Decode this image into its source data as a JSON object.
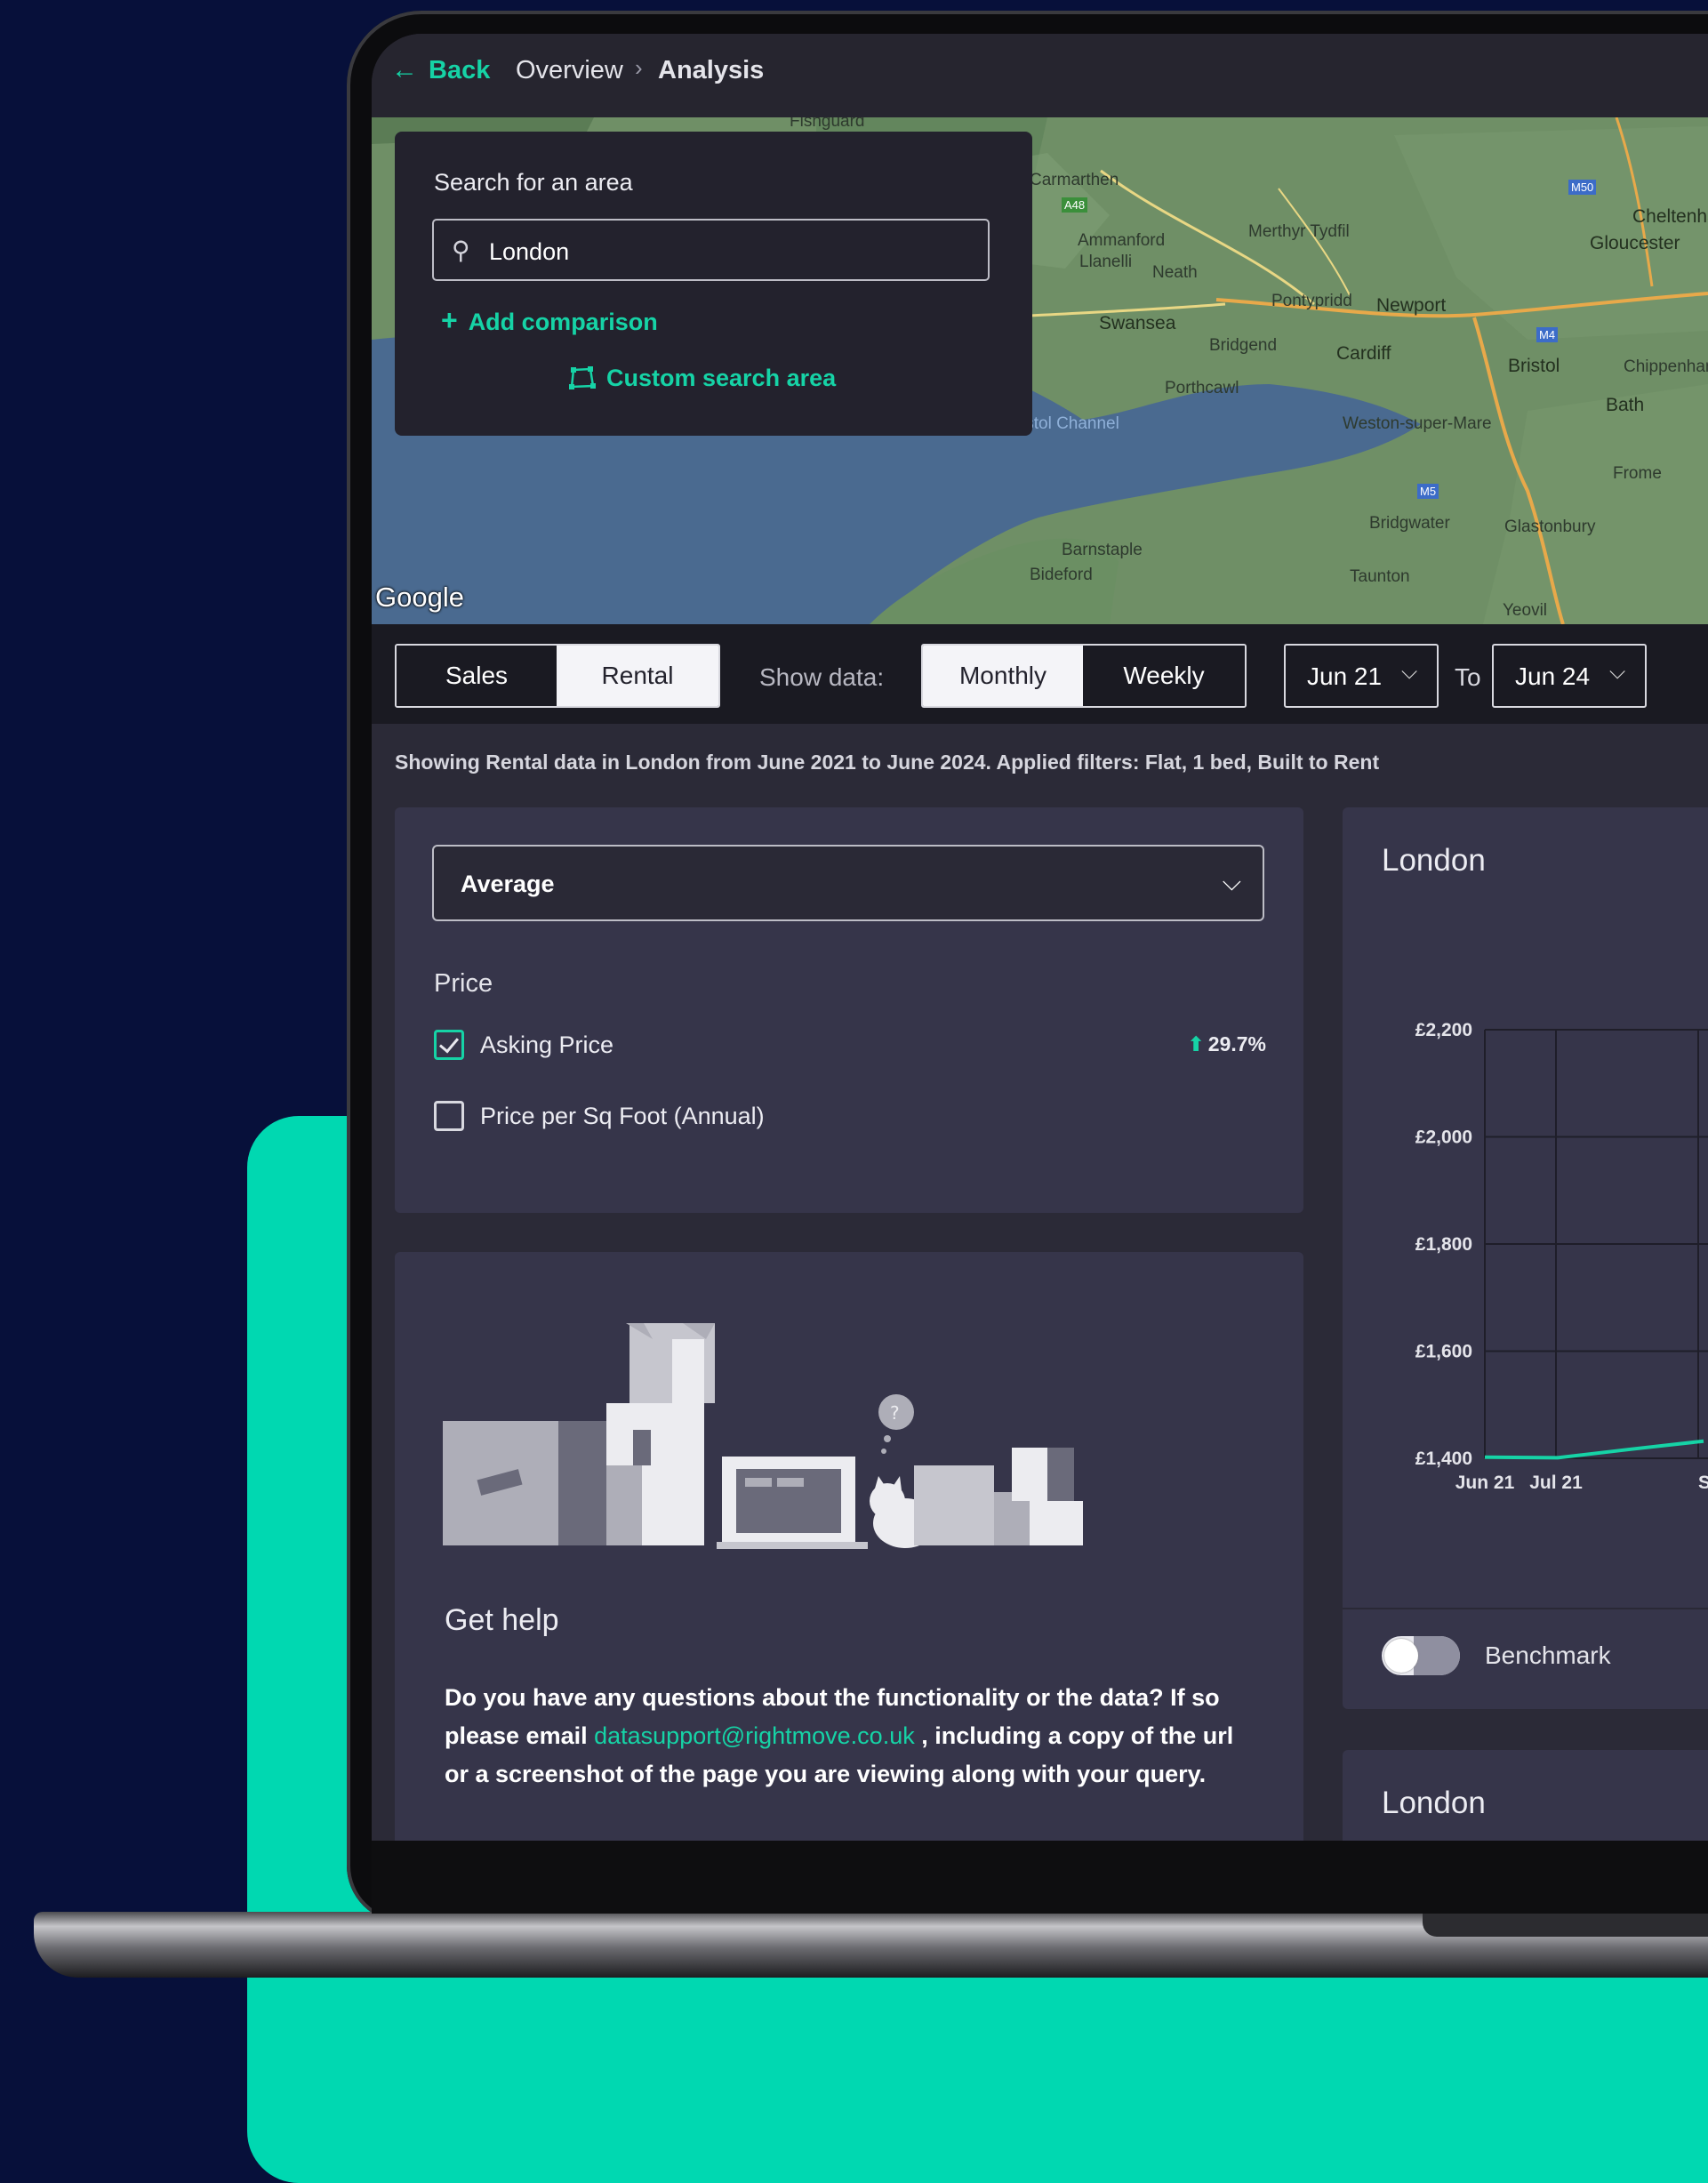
{
  "nav": {
    "back_label": "Back",
    "breadcrumbs": [
      "Overview",
      "Analysis"
    ]
  },
  "map": {
    "attribution": "Google",
    "labels": [
      "Fishguard",
      "Carmarthen",
      "Ammanford",
      "Llanelli",
      "Neath",
      "Merthyr Tydfil",
      "Pontypridd",
      "Newport",
      "Swansea",
      "Bridgend",
      "Cardiff",
      "Bristol",
      "Porthcawl",
      "Weston-super-Mare",
      "Bath",
      "Frome",
      "Chippenham",
      "Gloucester",
      "Cheltenham",
      "Bridgwater",
      "Glastonbury",
      "Barnstaple",
      "Bideford",
      "Taunton",
      "Yeovil",
      "Bristol Channel",
      "A48",
      "M4",
      "M5",
      "M50"
    ]
  },
  "search": {
    "title": "Search for an area",
    "value": "London",
    "add_comparison": "Add comparison",
    "custom_area": "Custom search area"
  },
  "controls": {
    "type_options": [
      "Sales",
      "Rental"
    ],
    "type_selected": "Rental",
    "show_data_label": "Show data:",
    "period_options": [
      "Monthly",
      "Weekly"
    ],
    "period_selected": "Monthly",
    "from": "Jun 21",
    "to_label": "To",
    "to": "Jun 24"
  },
  "summary": "Showing Rental data in London from June 2021 to June 2024. Applied filters: Flat, 1 bed, Built to Rent",
  "filters": {
    "measure": "Average",
    "section_title": "Price",
    "items": [
      {
        "label": "Asking Price",
        "checked": true,
        "change": "29.7%"
      },
      {
        "label": "Price per Sq Foot (Annual)",
        "checked": false
      }
    ]
  },
  "help": {
    "title": "Get help",
    "text_before": "Do you have any questions about the functionality or the data? If so please email ",
    "email": "datasupport@rightmove.co.uk",
    "text_after": " , including a copy of the url or a screenshot of the page you are viewing along with your query."
  },
  "chart": {
    "benchmark_label": "Benchmark",
    "second_card_title": "London"
  },
  "chart_data": {
    "type": "line",
    "title": "London",
    "y_ticks": [
      "£2,200",
      "£2,000",
      "£1,800",
      "£1,600",
      "£1,400"
    ],
    "ylim": [
      1400,
      2200
    ],
    "x_ticks": [
      "Jun 21",
      "Jul 21",
      "Sep"
    ],
    "series": [
      {
        "x": [
          "Jun 21",
          "Jul 21",
          "Aug 21",
          "Sep 21"
        ],
        "values": [
          1402,
          1401,
          1417,
          1432
        ]
      }
    ],
    "grid": true,
    "line_color": "#16d3a6"
  }
}
